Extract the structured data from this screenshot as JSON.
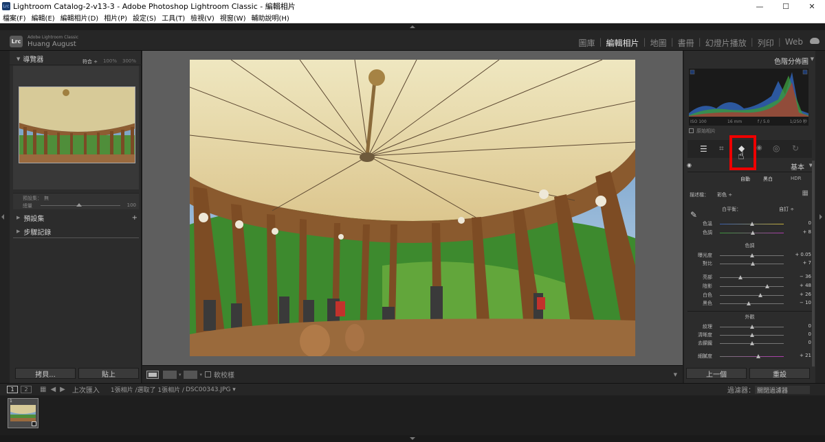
{
  "window": {
    "title": "Lightroom Catalog-2-v13-3 - Adobe Photoshop Lightroom Classic - 編輯相片",
    "logo": "Lrc",
    "min": "—",
    "max": "☐",
    "close": "✕"
  },
  "menu": [
    "檔案(F)",
    "編輯(E)",
    "編輯相片(D)",
    "相片(P)",
    "設定(S)",
    "工具(T)",
    "檢視(V)",
    "視窗(W)",
    "輔助說明(H)"
  ],
  "brand": {
    "logo": "Lrc",
    "product": "Adobe Lightroom Classic",
    "user": "Huang August"
  },
  "modules": [
    "圖庫",
    "編輯相片",
    "地圖",
    "書冊",
    "幻燈片播放",
    "列印",
    "Web"
  ],
  "left": {
    "navigator": "導覽器",
    "fit": "符合 ÷",
    "z100": "100%",
    "z300": "300%",
    "preset_label": "預設集：",
    "preset_value": "無",
    "amount_label": "總量",
    "amount_value": "100",
    "presets": "預設集",
    "history": "步驟記錄",
    "add": "+",
    "copy": "拷貝...",
    "paste": "貼上"
  },
  "right": {
    "histogram": "色階分佈圖",
    "iso": "ISO 100",
    "focal": "16 mm",
    "aperture": "f / 5.0",
    "shutter": "1/250 秒",
    "original": "原始相片",
    "basic": "基本",
    "auto": "自動",
    "bw": "黑白",
    "hdr": "HDR",
    "profile_label": "描述檔：",
    "profile_value": "彩色 ÷",
    "wb_label": "白平衡：",
    "wb_value": "自訂 ÷",
    "tone": "色調",
    "presence": "外觀",
    "sliders": [
      {
        "label": "色溫",
        "value": "0",
        "pos": 0.5
      },
      {
        "label": "色調",
        "value": "+ 8",
        "pos": 0.52
      },
      {
        "label": "曝光度",
        "value": "+ 0.05",
        "pos": 0.51
      },
      {
        "label": "對比",
        "value": "+ 7",
        "pos": 0.52
      },
      {
        "label": "亮部",
        "value": "− 36",
        "pos": 0.32
      },
      {
        "label": "陰影",
        "value": "+ 48",
        "pos": 0.74
      },
      {
        "label": "白色",
        "value": "+ 26",
        "pos": 0.63
      },
      {
        "label": "黑色",
        "value": "− 10",
        "pos": 0.45
      },
      {
        "label": "紋理",
        "value": "0",
        "pos": 0.5
      },
      {
        "label": "清晰度",
        "value": "0",
        "pos": 0.5
      },
      {
        "label": "去朦朧",
        "value": "0",
        "pos": 0.5
      },
      {
        "label": "細膩度",
        "value": "+ 21",
        "pos": 0.6
      }
    ],
    "prev": "上一個",
    "reset": "重設"
  },
  "toolbar": {
    "soft": "軟校樣"
  },
  "film": {
    "n1": "1",
    "n2": "2",
    "prev_import": "上次匯入",
    "info1": "1張相片 /選取了 1張相片 /",
    "file": "DSC00343.JPG ▾",
    "filter": "過濾器：",
    "filter_off": "關閉過濾器",
    "thumb_num": "1"
  }
}
